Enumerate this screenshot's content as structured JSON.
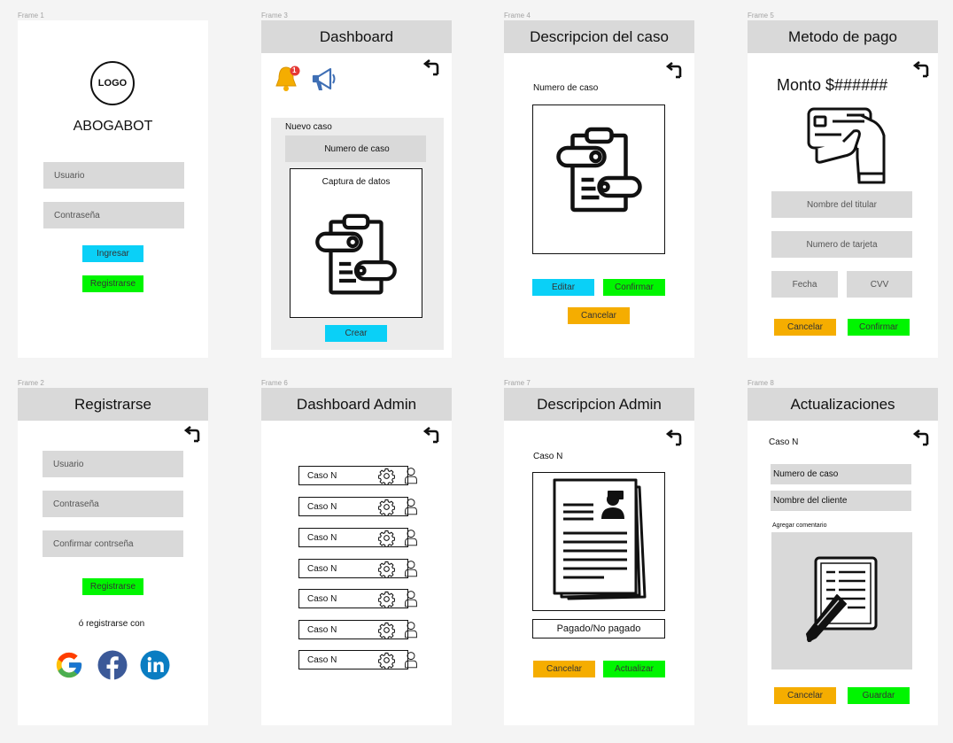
{
  "frames": {
    "f1": {
      "label": "Frame 1",
      "logo_text": "LOGO",
      "app_name": "ABOGABOT",
      "user_placeholder": "Usuario",
      "pass_placeholder": "Contraseña",
      "login_button": "Ingresar",
      "register_button": "Registrarse"
    },
    "f2": {
      "label": "Frame 2",
      "title": "Registrarse",
      "user_placeholder": "Usuario",
      "pass_placeholder": "Contraseña",
      "confirm_placeholder": "Confirmar contrseña",
      "register_button": "Registrarse",
      "alt_text": "ó registrarse con",
      "social": [
        "google",
        "facebook",
        "linkedin"
      ]
    },
    "f3": {
      "label": "Frame 3",
      "title": "Dashboard",
      "notification_count": "1",
      "section_title": "Nuevo caso",
      "case_number_field": "Numero de caso",
      "capture_label": "Captura de datos",
      "create_button": "Crear"
    },
    "f4": {
      "label": "Frame 4",
      "title": "Descripcion del caso",
      "case_label": "Numero de caso",
      "edit_button": "Editar",
      "confirm_button": "Confirmar",
      "cancel_button": "Cancelar"
    },
    "f5": {
      "label": "Frame 5",
      "title": "Metodo de pago",
      "amount": "Monto $######",
      "holder_placeholder": "Nombre del titular",
      "card_placeholder": "Numero de tarjeta",
      "date_placeholder": "Fecha",
      "cvv_placeholder": "CVV",
      "cancel_button": "Cancelar",
      "confirm_button": "Confirmar"
    },
    "f6": {
      "label": "Frame 6",
      "title": "Dashboard Admin",
      "cases": [
        "Caso N",
        "Caso N",
        "Caso N",
        "Caso N",
        "Caso N",
        "Caso N",
        "Caso N"
      ]
    },
    "f7": {
      "label": "Frame 7",
      "title": "Descripcion Admin",
      "case_label": "Caso N",
      "status_field": "Pagado/No pagado",
      "cancel_button": "Cancelar",
      "update_button": "Actualizar"
    },
    "f8": {
      "label": "Frame 8",
      "title": "Actualizaciones",
      "case_label": "Caso N",
      "case_number_field": "Numero de caso",
      "client_name_field": "Nombre del cliente",
      "comment_label": "Agregar comentario",
      "cancel_button": "Cancelar",
      "save_button": "Guardar"
    }
  },
  "colors": {
    "cyan": "#0ad0f7",
    "green": "#00f500",
    "orange": "#f5ad00",
    "header_gray": "#d9d9d9",
    "bell": "#f5ad00",
    "badge": "#e53935",
    "megaphone": "#3f6fb5"
  },
  "icons": [
    "back-arrow-icon",
    "bell-icon",
    "megaphone-icon",
    "clipboard-icon",
    "credit-card-hand-icon",
    "gear-icon",
    "user-icon",
    "resume-document-icon",
    "document-pencil-icon",
    "google-icon",
    "facebook-icon",
    "linkedin-icon"
  ]
}
